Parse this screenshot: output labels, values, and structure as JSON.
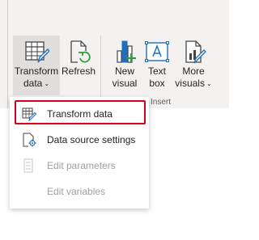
{
  "ribbon": {
    "buttons": [
      {
        "label_line1": "Transform",
        "label_line2": "data",
        "has_dropdown": true,
        "icon": "transform-data-icon"
      },
      {
        "label_line1": "Refresh",
        "label_line2": "",
        "has_dropdown": false,
        "icon": "refresh-icon"
      },
      {
        "label_line1": "New",
        "label_line2": "visual",
        "has_dropdown": false,
        "icon": "new-visual-icon"
      },
      {
        "label_line1": "Text",
        "label_line2": "box",
        "has_dropdown": false,
        "icon": "text-box-icon"
      },
      {
        "label_line1": "More",
        "label_line2": "visuals",
        "has_dropdown": true,
        "icon": "more-visuals-icon"
      }
    ],
    "group_label": "Insert"
  },
  "menu": {
    "items": [
      {
        "label": "Transform data",
        "enabled": true,
        "highlighted": true,
        "icon": "transform-data-icon"
      },
      {
        "label": "Data source settings",
        "enabled": true,
        "highlighted": false,
        "icon": "data-source-settings-icon"
      },
      {
        "label": "Edit parameters",
        "enabled": false,
        "highlighted": false,
        "icon": "edit-parameters-icon"
      },
      {
        "label": "Edit variables",
        "enabled": false,
        "highlighted": false,
        "icon": ""
      }
    ]
  },
  "colors": {
    "ribbon_bg": "#f3f2f1",
    "accent_blue": "#1f6fbf",
    "accent_green": "#2e9e3e",
    "highlight_red": "#d4001a",
    "disabled_text": "#a19f9d"
  }
}
